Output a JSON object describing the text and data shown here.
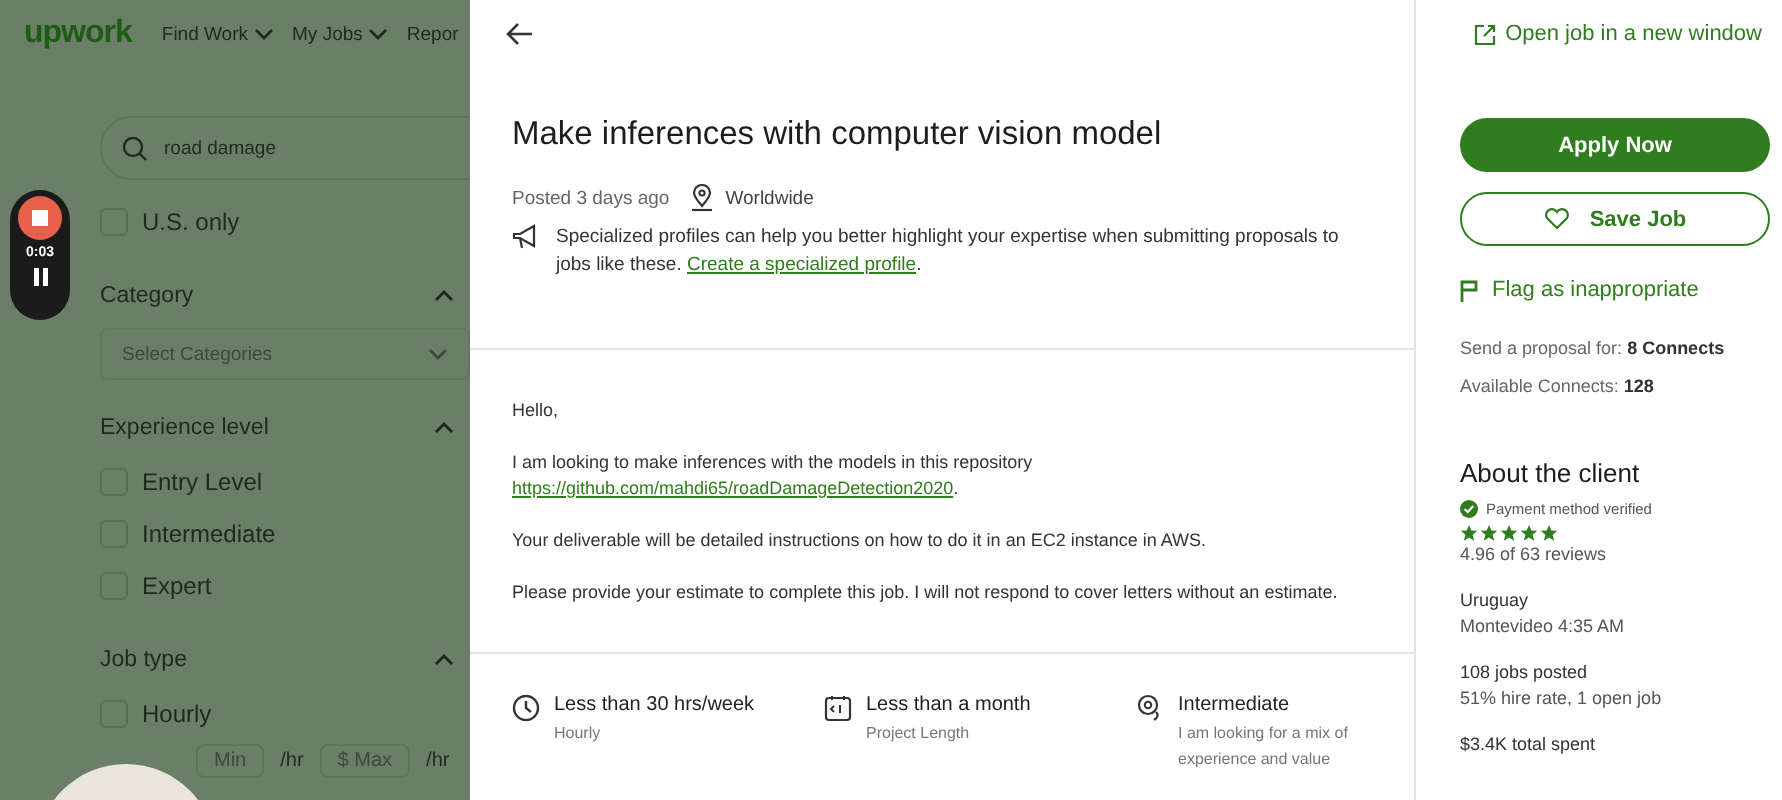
{
  "background_page": {
    "logo": "upwork",
    "nav": [
      {
        "label": "Find Work",
        "caret": true
      },
      {
        "label": "My Jobs",
        "caret": true
      },
      {
        "label": "Repor",
        "caret": false
      }
    ],
    "search": {
      "value": "road damage"
    },
    "us_only": {
      "label": "U.S. only",
      "checked": false
    },
    "filters": [
      {
        "title": "Category",
        "expanded": true,
        "dropdown": {
          "placeholder": "Select Categories"
        }
      },
      {
        "title": "Experience level",
        "expanded": true,
        "options": [
          {
            "label": "Entry Level",
            "checked": false
          },
          {
            "label": "Intermediate",
            "checked": false
          },
          {
            "label": "Expert",
            "checked": false
          }
        ]
      },
      {
        "title": "Job type",
        "expanded": true,
        "options": [
          {
            "label": "Hourly",
            "checked": false
          }
        ]
      }
    ],
    "rate": {
      "min_placeholder": "Min",
      "unit_1": "/hr",
      "currency": "$",
      "max_placeholder": "Max",
      "unit_2": "/hr"
    }
  },
  "recorder": {
    "time": "0:03"
  },
  "job": {
    "title": "Make inferences with computer vision model",
    "posted": "Posted 3 days ago",
    "location": "Worldwide",
    "tip": "Specialized profiles can help you better highlight your expertise when submitting proposals to jobs like these.",
    "tip_link": "Create a specialized profile",
    "tip_end": ".",
    "description": [
      {
        "text": "Hello,"
      },
      {
        "text": "I am looking to make inferences with the models in this repository",
        "link": "https://github.com/mahdi65/roadDamageDetection2020",
        "link_end": "."
      },
      {
        "text": "Your deliverable will be detailed instructions on how to do it in an EC2 instance in AWS."
      },
      {
        "text": "Please provide your estimate to complete this job. I will not respond to cover letters without an estimate."
      }
    ],
    "features": [
      {
        "kind": "clock",
        "title": "Less than 30 hrs/week",
        "subtitle": "Hourly"
      },
      {
        "kind": "calendar",
        "title": "Less than a month",
        "subtitle": "Project Length"
      },
      {
        "kind": "level",
        "title": "Intermediate",
        "subtitle": "I am looking for a mix of experience and value"
      }
    ]
  },
  "sidebar": {
    "open_link": "Open job in a new window",
    "apply_button": "Apply Now",
    "save_button": "Save Job",
    "flag_link": "Flag as inappropriate",
    "proposal": "Send a proposal for: **8 Connects**",
    "available": "Available Connects: **128**",
    "client": {
      "heading": "About the client",
      "payment": "Payment method verified",
      "stars": 5,
      "reviews": "4.96 of 63 reviews",
      "country": "Uruguay",
      "city_time": "Montevideo 4:35 AM",
      "jobs_posted": "108 jobs posted",
      "hire_rate": "51% hire rate, 1 open job",
      "total_spent": "$3.4K total spent"
    }
  }
}
